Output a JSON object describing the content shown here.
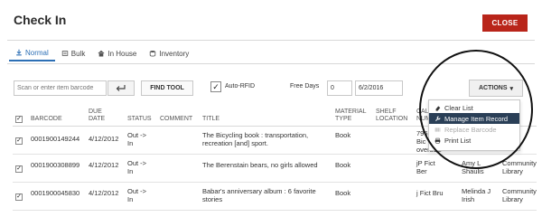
{
  "header": {
    "title": "Check In",
    "close_label": "CLOSE"
  },
  "tabs": [
    {
      "label": "Normal",
      "icon": "download-icon",
      "active": true
    },
    {
      "label": "Bulk",
      "icon": "bulk-icon",
      "active": false
    },
    {
      "label": "In House",
      "icon": "home-icon",
      "active": false
    },
    {
      "label": "Inventory",
      "icon": "database-icon",
      "active": false
    }
  ],
  "toolbar": {
    "scan_placeholder": "Scan or enter item barcode",
    "find_tool_label": "FIND TOOL",
    "auto_rfid_label": "Auto-RFID",
    "auto_rfid_checked": true,
    "free_days_label": "Free Days",
    "free_days_value": "0",
    "date_value": "6/2/2016",
    "actions_label": "ACTIONS"
  },
  "actions_menu": [
    {
      "label": "Clear List",
      "icon": "eraser-icon",
      "highlighted": false,
      "disabled": false
    },
    {
      "label": "Manage Item Record",
      "icon": "wrench-icon",
      "highlighted": true,
      "disabled": false
    },
    {
      "label": "Replace Barcode",
      "icon": "barcode-icon",
      "highlighted": false,
      "disabled": true
    },
    {
      "label": "Print List",
      "icon": "print-icon",
      "highlighted": false,
      "disabled": false
    }
  ],
  "table": {
    "headers": {
      "barcode": "BARCODE",
      "due_date_1": "DUE",
      "due_date_2": "DATE",
      "status": "STATUS",
      "comment": "COMMENT",
      "title": "TITLE",
      "material_type_1": "MATERIAL",
      "material_type_2": "TYPE",
      "shelf_location_1": "SHELF",
      "shelf_location_2": "LOCATION",
      "call_number_1": "CAL",
      "call_number_2": "NUM"
    },
    "rows": [
      {
        "barcode": "0001900149244",
        "due_date": "4/12/2012",
        "status_1": "Out ->",
        "status_2": "In",
        "title_1": "The Bicycling book : transportation,",
        "title_2": "recreation [and] sport.",
        "material_type": "Book",
        "call_1": "796",
        "call_2": "Bic",
        "call_3": "oversize",
        "author_1": "",
        "author_2": "",
        "library_1": "",
        "library_2": ""
      },
      {
        "barcode": "0001900308899",
        "due_date": "4/12/2012",
        "status_1": "Out ->",
        "status_2": "In",
        "title_1": "The Berenstain bears, no girls allowed",
        "title_2": "",
        "material_type": "Book",
        "call_1": "jP Fict",
        "call_2": "Ber",
        "call_3": "",
        "author_1": "Amy L",
        "author_2": "Shaulis",
        "library_1": "Community",
        "library_2": "Library"
      },
      {
        "barcode": "0001900045830",
        "due_date": "4/12/2012",
        "status_1": "Out ->",
        "status_2": "In",
        "title_1": "Babar's anniversary album : 6 favorite",
        "title_2": "stories",
        "material_type": "Book",
        "call_1": "j Fict Bru",
        "call_2": "",
        "call_3": "",
        "author_1": "Melinda J",
        "author_2": "Irish",
        "library_1": "Community",
        "library_2": "Library"
      }
    ]
  }
}
